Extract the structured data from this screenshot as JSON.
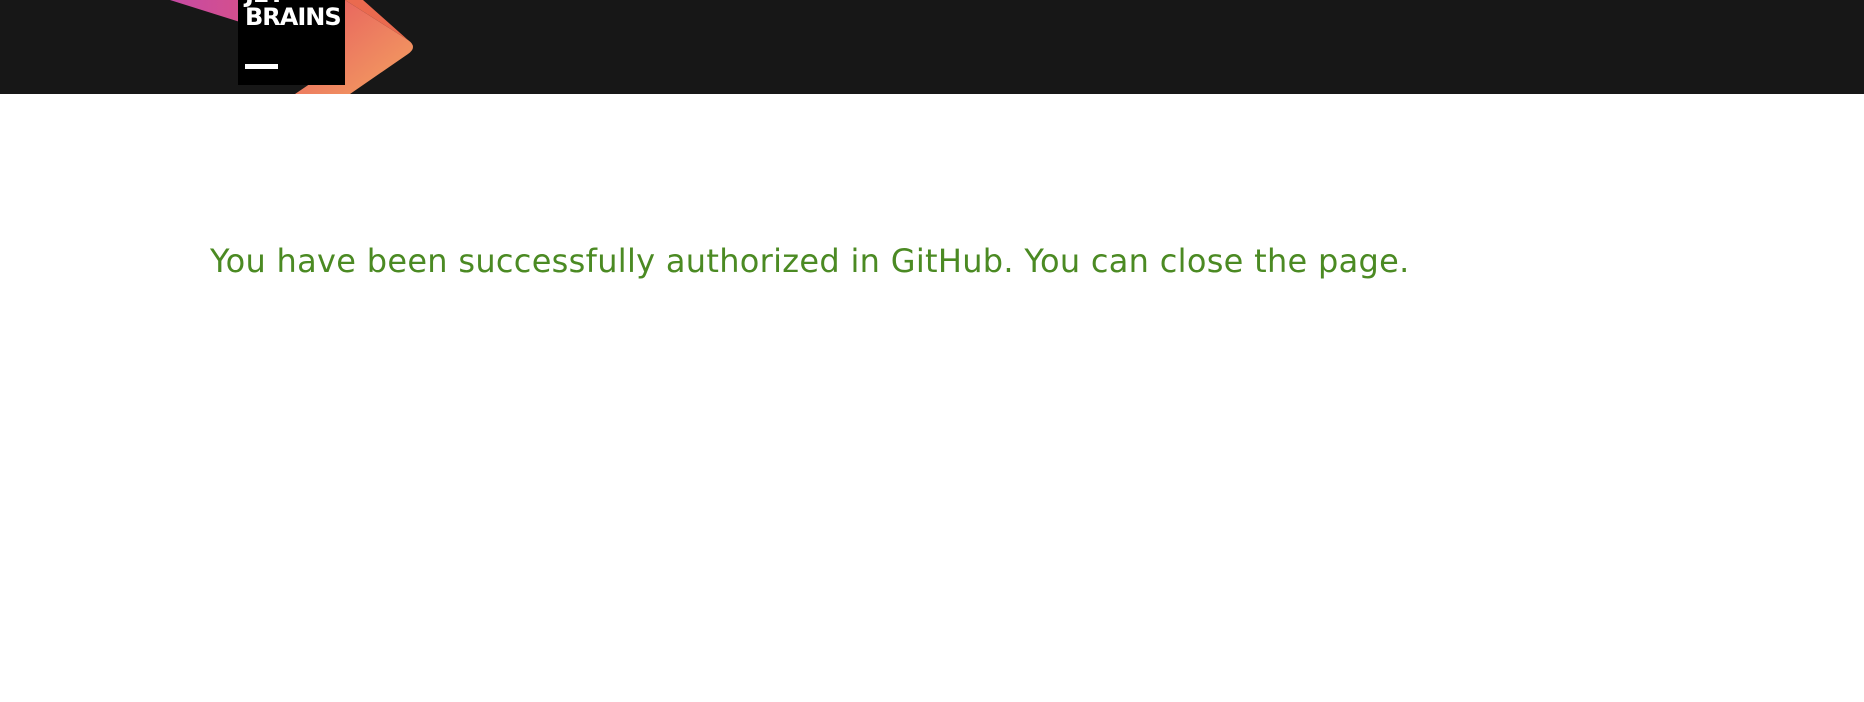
{
  "header": {
    "logo": {
      "text_top": "JET",
      "text": "BRAINS"
    }
  },
  "main": {
    "message": "You have been successfully authorized in GitHub. You can close the page."
  },
  "colors": {
    "header_bg": "#171717",
    "message": "#4b8a23",
    "logo_pink": "#c64aa3",
    "logo_orange": "#f08a4b"
  }
}
